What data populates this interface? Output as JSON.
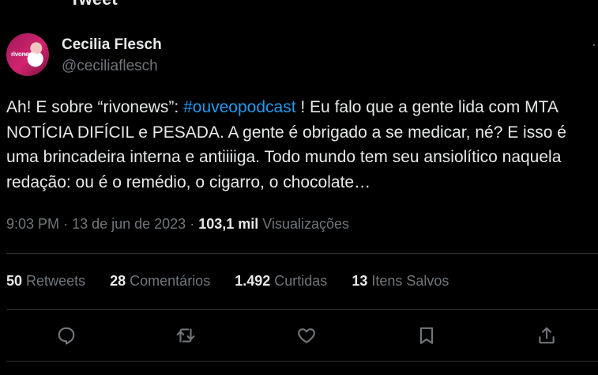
{
  "top_partial_text": "Tweet",
  "author": {
    "display_name": "Cecilia Flesch",
    "handle": "@ceciliaflesch",
    "avatar_label": "rivonews"
  },
  "tweet": {
    "text_before": "Ah! E sobre “rivonews”: ",
    "hashtag": "#ouveopodcast",
    "text_after": " ! Eu falo que a gente lida com MTA NOTÍCIA DIFÍCIL e PESADA. A gente é obrigado a se medicar, né? E isso é uma brincadeira interna e antiiiiga. Todo mundo tem seu ansiolítico naquela redação: ou é o remédio, o cigarro, o chocolate…"
  },
  "meta": {
    "time": "9:03 PM",
    "date": "13 de jun de 2023",
    "views_count": "103,1 mil",
    "views_label": "Visualizações"
  },
  "stats": {
    "retweets_count": "50",
    "retweets_label": "Retweets",
    "comments_count": "28",
    "comments_label": "Comentários",
    "likes_count": "1.492",
    "likes_label": "Curtidas",
    "saves_count": "13",
    "saves_label": "Itens Salvos"
  },
  "icons": {
    "reply": "reply-icon",
    "retweet": "retweet-icon",
    "like": "heart-icon",
    "bookmark": "bookmark-icon",
    "share": "share-icon",
    "more": "more-icon"
  },
  "colors": {
    "background": "#000000",
    "text": "#e7e9ea",
    "secondary": "#71767b",
    "accent": "#1d9bf0",
    "divider": "#2f3336"
  }
}
